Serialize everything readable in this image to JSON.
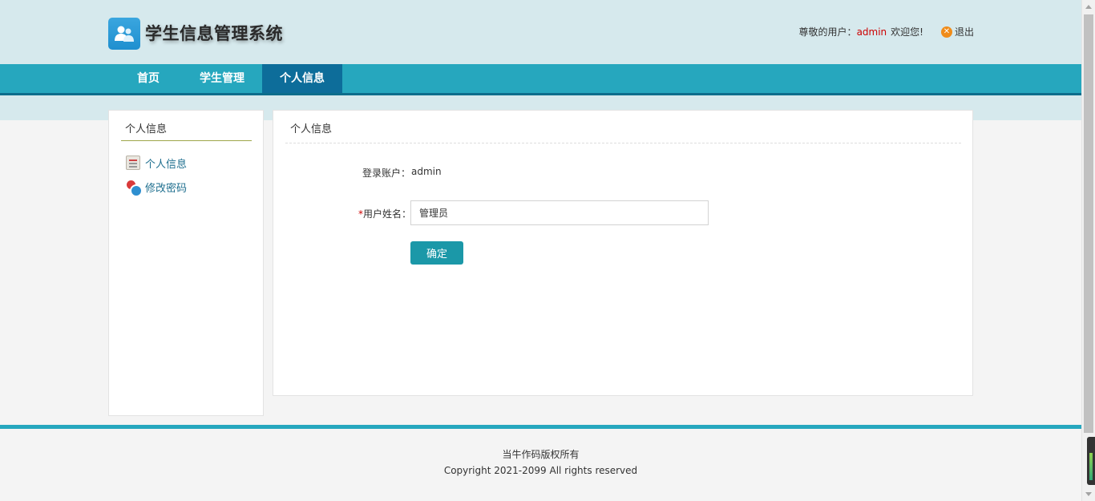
{
  "header": {
    "app_title": "学生信息管理系统",
    "greeting_prefix": "尊敬的用户：",
    "username": "admin",
    "greeting_suffix": "欢迎您!",
    "logout_label": "退出",
    "logout_icon": "close-circle-icon"
  },
  "nav": {
    "items": [
      {
        "label": "首页",
        "active": false
      },
      {
        "label": "学生管理",
        "active": false
      },
      {
        "label": "个人信息",
        "active": true
      }
    ]
  },
  "sidebar": {
    "title": "个人信息",
    "items": [
      {
        "label": "个人信息",
        "icon": "document-list-icon"
      },
      {
        "label": "修改密码",
        "icon": "user-lock-icon"
      }
    ]
  },
  "main": {
    "title": "个人信息",
    "account_label": "登录账户：",
    "account_value": "admin",
    "name_required_mark": "*",
    "name_label": "用户姓名：",
    "name_value": "管理员",
    "submit_label": "确定"
  },
  "footer": {
    "line1": "当牛作码版权所有",
    "line2": "Copyright 2021-2099 All rights reserved"
  },
  "colors": {
    "nav_bg": "#26a7be",
    "nav_active": "#0d6d9a",
    "button": "#1b98a8",
    "username": "#cc0000"
  }
}
